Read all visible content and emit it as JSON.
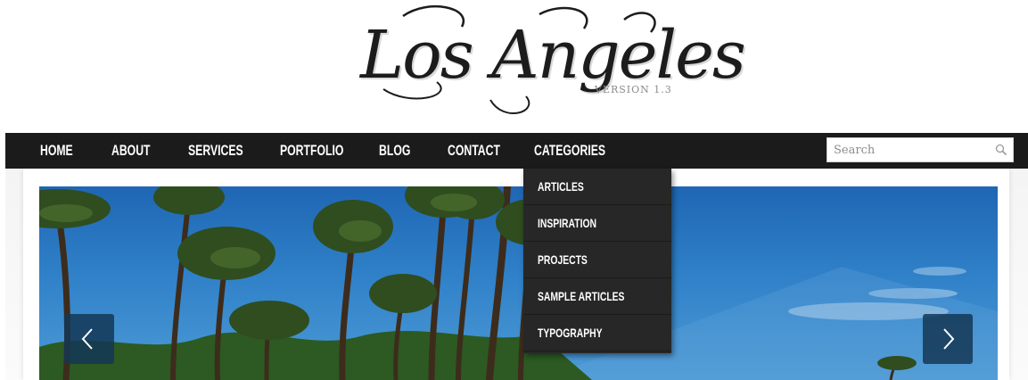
{
  "logo": {
    "title": "Los Angeles",
    "version": "VERSION 1.3"
  },
  "nav": {
    "items": [
      {
        "label": "HOME"
      },
      {
        "label": "ABOUT"
      },
      {
        "label": "SERVICES"
      },
      {
        "label": "PORTFOLIO"
      },
      {
        "label": "BLOG"
      },
      {
        "label": "CONTACT"
      },
      {
        "label": "CATEGORIES"
      }
    ]
  },
  "search": {
    "placeholder": "Search",
    "icon": "magnifier-icon"
  },
  "categories_dropdown": {
    "items": [
      {
        "label": "ARTICLES"
      },
      {
        "label": "INSPIRATION"
      },
      {
        "label": "PROJECTS"
      },
      {
        "label": "SAMPLE ARTICLES"
      },
      {
        "label": "TYPOGRAPHY"
      }
    ]
  },
  "slider": {
    "prev_icon": "chevron-left-icon",
    "next_icon": "chevron-right-icon"
  },
  "colors": {
    "nav_background": "#1b1b1b",
    "dropdown_background": "#272727",
    "arrow_background": "#143755",
    "sky": "#2f80c8"
  }
}
